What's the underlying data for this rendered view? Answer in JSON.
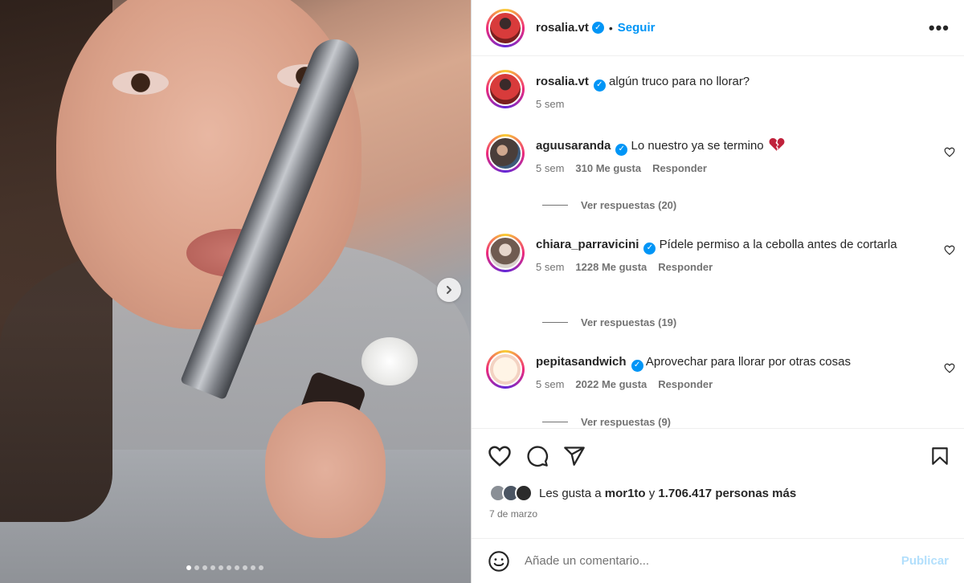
{
  "post": {
    "author": "rosalia.vt",
    "follow_label": "Seguir",
    "separator": "•",
    "more_label": "•••",
    "caption": "algún truco para no llorar?",
    "caption_time": "5 sem"
  },
  "carousel": {
    "slide_count": 10,
    "active_index": 0
  },
  "comments": [
    {
      "user": "aguusaranda",
      "text": "Lo nuestro ya se termino",
      "time": "5 sem",
      "likes": "310 Me gusta",
      "reply_label": "Responder",
      "view_replies": "Ver respuestas (20)"
    },
    {
      "user": "chiara_parravicini",
      "text": "Pídele permiso a la cebolla antes de cortarla",
      "time": "5 sem",
      "likes": "1228 Me gusta",
      "reply_label": "Responder",
      "view_replies": "Ver respuestas (19)"
    },
    {
      "user": "pepitasandwich",
      "text": "Aprovechar para llorar por otras cosas",
      "time": "5 sem",
      "likes": "2022 Me gusta",
      "reply_label": "Responder",
      "view_replies": "Ver respuestas (9)"
    }
  ],
  "likes": {
    "prefix": "Les gusta a",
    "user": "mor1to",
    "connector": "y",
    "count": "1.706.417 personas más"
  },
  "date": "7 de marzo",
  "composer": {
    "placeholder": "Añade un comentario...",
    "publish_label": "Publicar"
  },
  "colors": {
    "accent": "#0095f6",
    "publish_disabled": "#b2dffc",
    "broken_heart": "#c0213b",
    "secondary_text": "#737373"
  },
  "icons": [
    "chevron-right-icon",
    "heart-icon",
    "comment-icon",
    "share-icon",
    "bookmark-icon",
    "emoji-icon",
    "verified-icon",
    "more-icon",
    "broken-heart-icon"
  ]
}
